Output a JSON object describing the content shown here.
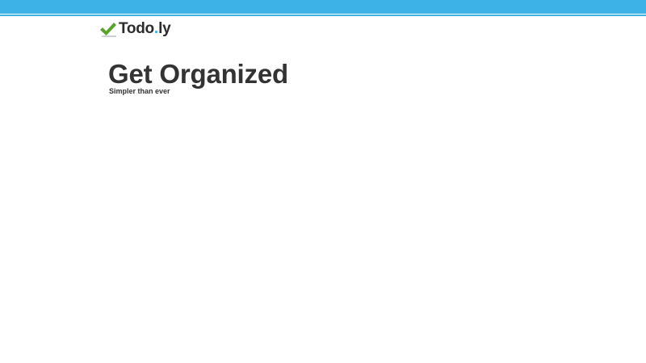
{
  "header": {
    "bar_color": "#3cb2e6",
    "logo": {
      "icon": "checkmark-icon",
      "name_main": "Todo",
      "name_dot": ".",
      "name_suffix": "ly",
      "check_color": "#59a52c",
      "dot_color": "#3cb2e6"
    }
  },
  "hero": {
    "title": "Get Organized",
    "subtitle": "Simpler than ever"
  }
}
